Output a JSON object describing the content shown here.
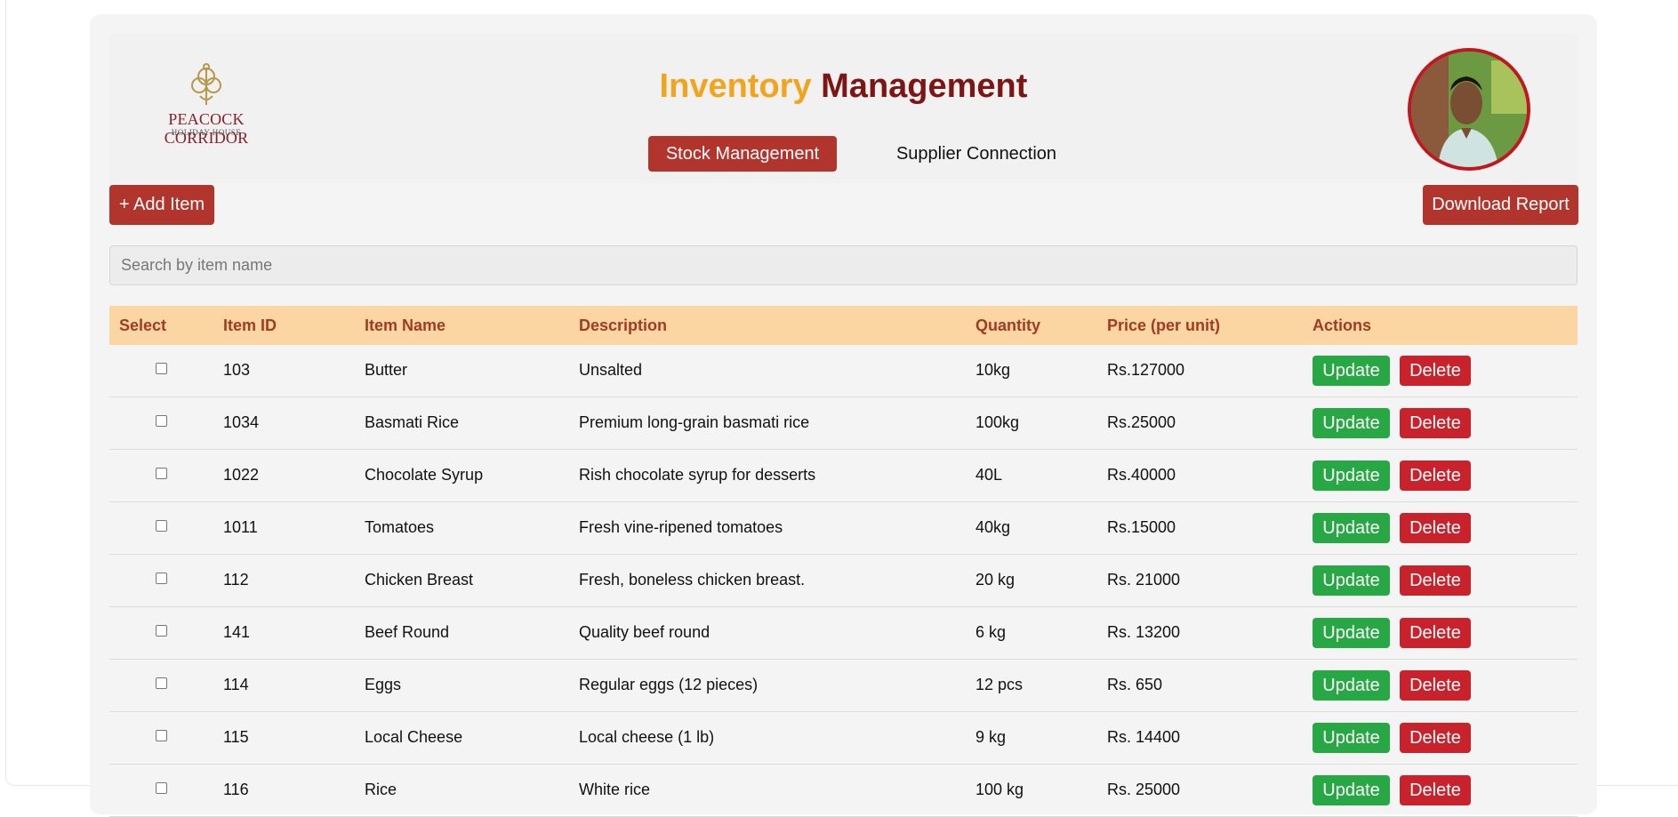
{
  "header": {
    "logo": {
      "name": "PEACOCK CORRIDOR",
      "subtitle": "HOLIDAY HOUSE"
    },
    "title_accent": "Inventory",
    "title_main": "Management",
    "tabs": [
      {
        "label": "Stock Management",
        "active": true
      },
      {
        "label": "Supplier Connection",
        "active": false
      }
    ]
  },
  "toolbar": {
    "add_label": "+ Add Item",
    "download_label": "Download Report"
  },
  "search": {
    "placeholder": "Search by item name",
    "value": ""
  },
  "table": {
    "columns": [
      "Select",
      "Item ID",
      "Item Name",
      "Description",
      "Quantity",
      "Price (per unit)",
      "Actions"
    ],
    "update_label": "Update",
    "delete_label": "Delete",
    "rows": [
      {
        "id": "103",
        "name": "Butter",
        "description": "Unsalted",
        "quantity": "10kg",
        "price": "Rs.127000"
      },
      {
        "id": "1034",
        "name": "Basmati Rice",
        "description": "Premium long-grain basmati rice",
        "quantity": "100kg",
        "price": "Rs.25000"
      },
      {
        "id": "1022",
        "name": "Chocolate Syrup",
        "description": "Rish chocolate syrup for desserts",
        "quantity": "40L",
        "price": "Rs.40000"
      },
      {
        "id": "1011",
        "name": "Tomatoes",
        "description": "Fresh vine-ripened tomatoes",
        "quantity": "40kg",
        "price": "Rs.15000"
      },
      {
        "id": "112",
        "name": "Chicken Breast",
        "description": "Fresh, boneless chicken breast.",
        "quantity": "20 kg",
        "price": "Rs. 21000"
      },
      {
        "id": "141",
        "name": "Beef Round",
        "description": "Quality beef round",
        "quantity": "6 kg",
        "price": "Rs. 13200"
      },
      {
        "id": "114",
        "name": "Eggs",
        "description": "Regular eggs (12 pieces)",
        "quantity": "12 pcs",
        "price": "Rs. 650"
      },
      {
        "id": "115",
        "name": "Local Cheese",
        "description": "Local cheese (1 lb)",
        "quantity": "9 kg",
        "price": "Rs. 14400"
      },
      {
        "id": "116",
        "name": "Rice",
        "description": "White rice",
        "quantity": "100 kg",
        "price": "Rs. 25000"
      }
    ]
  },
  "colors": {
    "accent_red": "#b2352d",
    "title_orange": "#f3a41d",
    "title_maroon": "#7e1515",
    "table_header_bg": "#fbd6a3",
    "update_green": "#28a745",
    "delete_red": "#c8232c"
  }
}
